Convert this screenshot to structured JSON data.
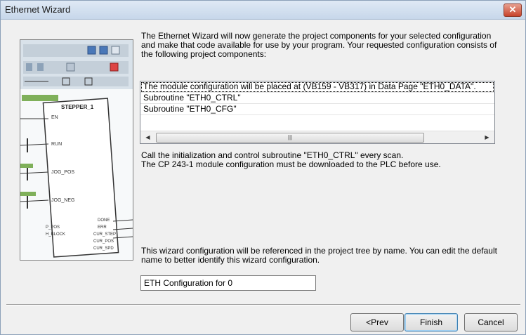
{
  "window": {
    "title": "Ethernet Wizard"
  },
  "title_bar": {
    "close_glyph": "✕"
  },
  "intro_text": "The Ethernet Wizard will now generate the project components for your selected configuration and make that code available for use by your program. Your requested configuration consists of the following project components:",
  "components": {
    "items": [
      "The module configuration will be placed at (VB159 - VB317) in Data Page \"ETH0_DATA\".",
      "Subroutine \"ETH0_CTRL\"",
      "Subroutine \"ETH0_CFG\""
    ],
    "scrollbar": {
      "left_arrow": "◀",
      "right_arrow": "▶",
      "thumb_grip": "|||"
    }
  },
  "note_line_1": "Call the initialization and control subroutine \"ETH0_CTRL\" every scan.",
  "note_line_2": "The CP 243-1  module configuration must be downloaded to the PLC before use.",
  "reference_text": "This wizard configuration will be referenced in the project tree by name. You can edit the default name to better identify this wizard configuration.",
  "config_name": "ETH Configuration for 0",
  "buttons": {
    "prev": "<Prev",
    "finish": "Finish",
    "cancel": "Cancel"
  },
  "illustration": {
    "block_title": "STEPPER_1",
    "pins_left": [
      "EN",
      "RUN",
      "JOG_POS",
      "JOG_NEG",
      "P_POS",
      "H_BLOCK"
    ],
    "pins_right": [
      "DONE",
      "ERR",
      "CUR_STEP",
      "CUR_POS",
      "CUR_SPD"
    ]
  }
}
